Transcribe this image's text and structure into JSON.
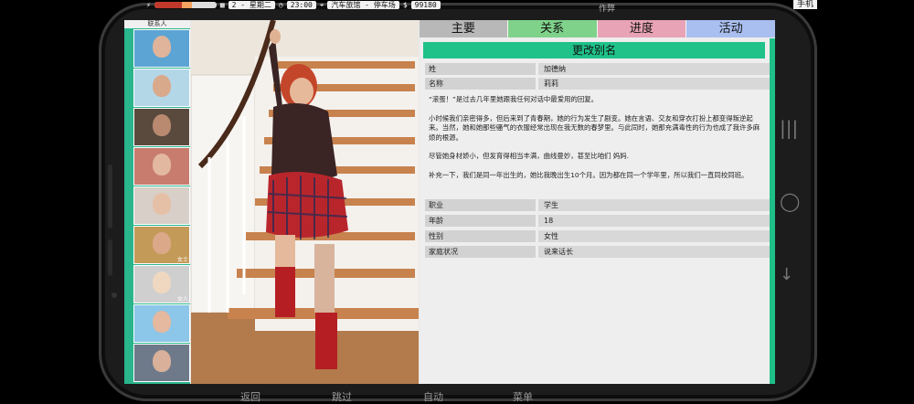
{
  "status": {
    "day": "2 - 星期二",
    "time": "23:00",
    "location": "汽车旅馆 - 停车场",
    "money": "99180",
    "cheat": "作弊",
    "phone": "手机",
    "health_fraction": 0.45
  },
  "contacts": {
    "title": "联系人",
    "items": [
      {
        "label": "",
        "bg": "#5ca4d4",
        "face": "#e0b49a"
      },
      {
        "label": "",
        "bg": "#b4d7e8",
        "face": "#d9a98b"
      },
      {
        "label": "",
        "bg": "#5a4a3e",
        "face": "#b98a70"
      },
      {
        "label": "",
        "bg": "#c87c6e",
        "face": "#e2b9a0"
      },
      {
        "label": "",
        "bg": "#d8cfc8",
        "face": "#e6c0a6"
      },
      {
        "label": "女士",
        "bg": "#c49a58",
        "face": "#dba98a"
      },
      {
        "label": "女人",
        "bg": "#cfcfcf",
        "face": "#f0d8c0"
      },
      {
        "label": "",
        "bg": "#8cc6e8",
        "face": "#e4b9a0"
      },
      {
        "label": "",
        "bg": "#6e7a8a",
        "face": "#d9b09a"
      }
    ]
  },
  "tabs": [
    {
      "label": "主要",
      "color": "#b8b8b8"
    },
    {
      "label": "关系",
      "color": "#7fd28a"
    },
    {
      "label": "进度",
      "color": "#e8a3b6"
    },
    {
      "label": "活动",
      "color": "#a9bff0"
    }
  ],
  "profile": {
    "rename_label": "更改别名",
    "surname_key": "姓",
    "surname_value": "加德纳",
    "name_key": "名称",
    "name_value": "莉莉",
    "bio": [
      "“滚蛋！”是过去几年里她跟我任何对话中最爱用的回复。",
      "小时候我们亲密得多，但后来到了青春期，她的行为发生了剧变。她在言语、交友和穿衣打扮上都变得叛逆起来。当然，她和她那些骚气的衣服经常出现在我无数的春梦里。与此同时，她那充满毒性的行为也成了我许多麻烦的根源。",
      "尽管她身材娇小，但发育得相当丰满，曲线曼妙，甚至比咱们 妈妈.",
      "补充一下，我们是同一年出生的，她比我晚出生10个月。因为都在同一个学年里，所以我们一直同校同班。"
    ],
    "job_key": "职业",
    "job_value": "学生",
    "age_key": "年龄",
    "age_value": "18",
    "gender_key": "性别",
    "gender_value": "女性",
    "family_key": "家庭状况",
    "family_value": "说来话长"
  },
  "bottom_menu": {
    "back": "返回",
    "skip": "跳过",
    "auto": "自动",
    "menu": "菜单"
  }
}
